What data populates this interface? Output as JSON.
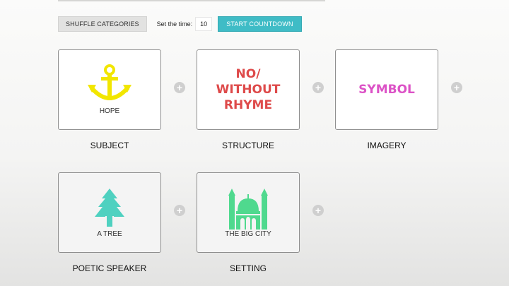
{
  "toolbar": {
    "shuffle_label": "SHUFFLE CATEGORIES",
    "time_label": "Set the time:",
    "time_value": "10",
    "start_label": "START COUNTDOWN"
  },
  "cards": [
    {
      "category": "SUBJECT",
      "value": "HOPE",
      "icon": "anchor-icon",
      "color": "#f2e600"
    },
    {
      "category": "STRUCTURE",
      "value": "NO/ WITHOUT RHYME",
      "lines": [
        "NO/",
        "WITHOUT",
        "RHYME"
      ],
      "color": "#de4a4a"
    },
    {
      "category": "IMAGERY",
      "value": "SYMBOL",
      "color": "#dc52c6"
    },
    {
      "category": "POETIC SPEAKER",
      "value": "A TREE",
      "icon": "tree-icon",
      "color": "#4fd1c0"
    },
    {
      "category": "SETTING",
      "value": "THE BIG CITY",
      "icon": "mosque-icon",
      "color": "#4fd98e"
    }
  ],
  "plus_icon": "plus-icon"
}
